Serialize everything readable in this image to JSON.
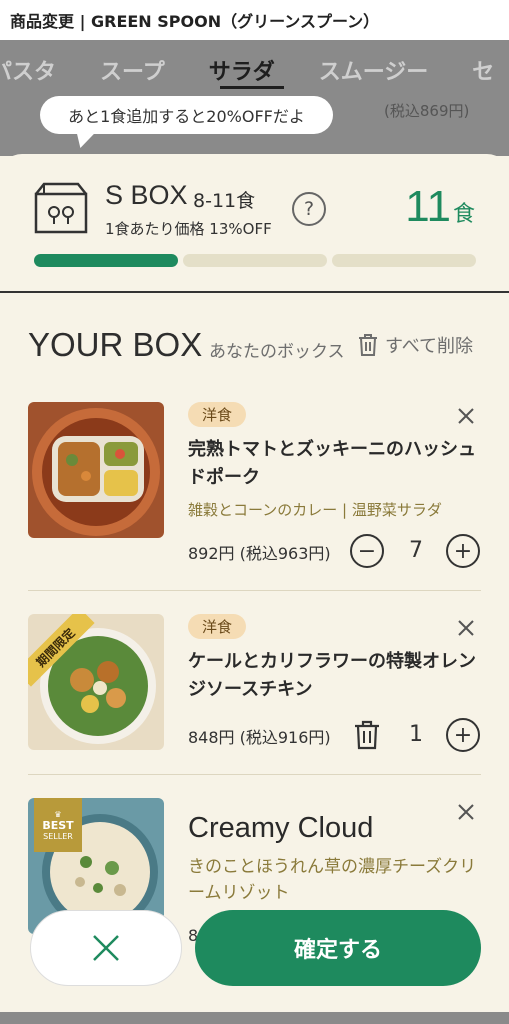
{
  "title_bar": {
    "text": "商品変更 | GREEN SPOON（グリーンスプーン）"
  },
  "tabs": [
    {
      "label": "パスタ"
    },
    {
      "label": "スープ"
    },
    {
      "label": "サラダ",
      "active": true
    },
    {
      "label": "スムージー"
    },
    {
      "label": "セ"
    }
  ],
  "behind_price": "(税込869円)",
  "tooltip": {
    "text": "あと1食追加すると20%OFFだよ"
  },
  "box": {
    "name": "S BOX",
    "range": "8-11食",
    "discount": "1食あたり価格 13%OFF",
    "help": "?",
    "count": "11",
    "count_unit": "食",
    "progress_segments_filled": 1,
    "progress_segments_total": 3
  },
  "your_box": {
    "title": "YOUR BOX",
    "subtitle": "あなたのボックス",
    "delete_all": "すべて削除"
  },
  "items": [
    {
      "category": "洋食",
      "name": "完熟トマトとズッキーニのハッシュドポーク",
      "sides": "雑穀とコーンのカレー | 温野菜サラダ",
      "price": "892円 (税込963円)",
      "quantity": "7",
      "minus": "−",
      "plus": "+"
    },
    {
      "category": "洋食",
      "ribbon": "期間限定",
      "name": "ケールとカリフラワーの特製オレンジソースチキン",
      "price": "848円 (税込916円)",
      "quantity": "1",
      "plus": "+"
    },
    {
      "ribbon_line1": "BEST",
      "ribbon_line2": "SELLER",
      "name": "Creamy Cloud",
      "sides": "きのことほうれん草の濃厚チーズクリームリゾット",
      "price_partial": "8"
    }
  ],
  "footer": {
    "confirm": "確定する"
  },
  "colors": {
    "accent_green": "#1e8a5e",
    "background": "#f7f3e7",
    "badge_bg": "#f5dcb4",
    "sides_text": "#8a7a3a"
  }
}
